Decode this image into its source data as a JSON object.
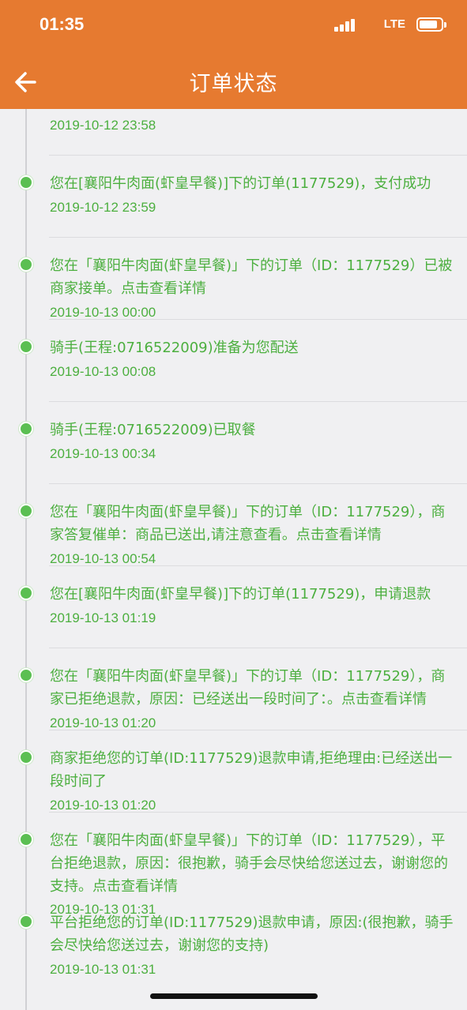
{
  "status_bar": {
    "time": "01:35",
    "network": "LTE",
    "icons": [
      "signal-icon",
      "battery-icon"
    ]
  },
  "nav": {
    "title": "订单状态",
    "back_icon": "arrow-left-icon"
  },
  "colors": {
    "header": "#e67a30",
    "text_green": "#4caf3f",
    "dot_green": "#5bbf52",
    "background": "#f0f0f2"
  },
  "events": [
    {
      "text": "",
      "time": "2019-10-12 23:58"
    },
    {
      "text": "您在[襄阳牛肉面(虾皇早餐)]下的订单(1177529)，支付成功",
      "time": "2019-10-12 23:59"
    },
    {
      "text": "您在「襄阳牛肉面(虾皇早餐)」下的订单（ID：1177529）已被商家接单。点击查看详情",
      "time": "2019-10-13 00:00"
    },
    {
      "text": "骑手(王程:0716522009)准备为您配送",
      "time": "2019-10-13 00:08"
    },
    {
      "text": "骑手(王程:0716522009)已取餐",
      "time": "2019-10-13 00:34"
    },
    {
      "text": "您在「襄阳牛肉面(虾皇早餐)」下的订单（ID：1177529），商家答复催单：商品已送出,请注意查看。点击查看详情",
      "time": "2019-10-13 00:54"
    },
    {
      "text": "您在[襄阳牛肉面(虾皇早餐)]下的订单(1177529)，申请退款",
      "time": "2019-10-13 01:19"
    },
    {
      "text": "您在「襄阳牛肉面(虾皇早餐)」下的订单（ID：1177529），商家已拒绝退款，原因：已经送出一段时间了：。点击查看详情",
      "time": "2019-10-13 01:20"
    },
    {
      "text": "商家拒绝您的订单(ID:1177529)退款申请,拒绝理由:已经送出一段时间了",
      "time": "2019-10-13 01:20"
    },
    {
      "text": "您在「襄阳牛肉面(虾皇早餐)」下的订单（ID：1177529），平台拒绝退款，原因：很抱歉，骑手会尽快给您送过去，谢谢您的支持。点击查看详情",
      "time": "2019-10-13 01:31"
    },
    {
      "text": "平台拒绝您的订单(ID:1177529)退款申请，原因:(很抱歉，骑手会尽快给您送过去，谢谢您的支持)",
      "time": "2019-10-13 01:31"
    }
  ]
}
